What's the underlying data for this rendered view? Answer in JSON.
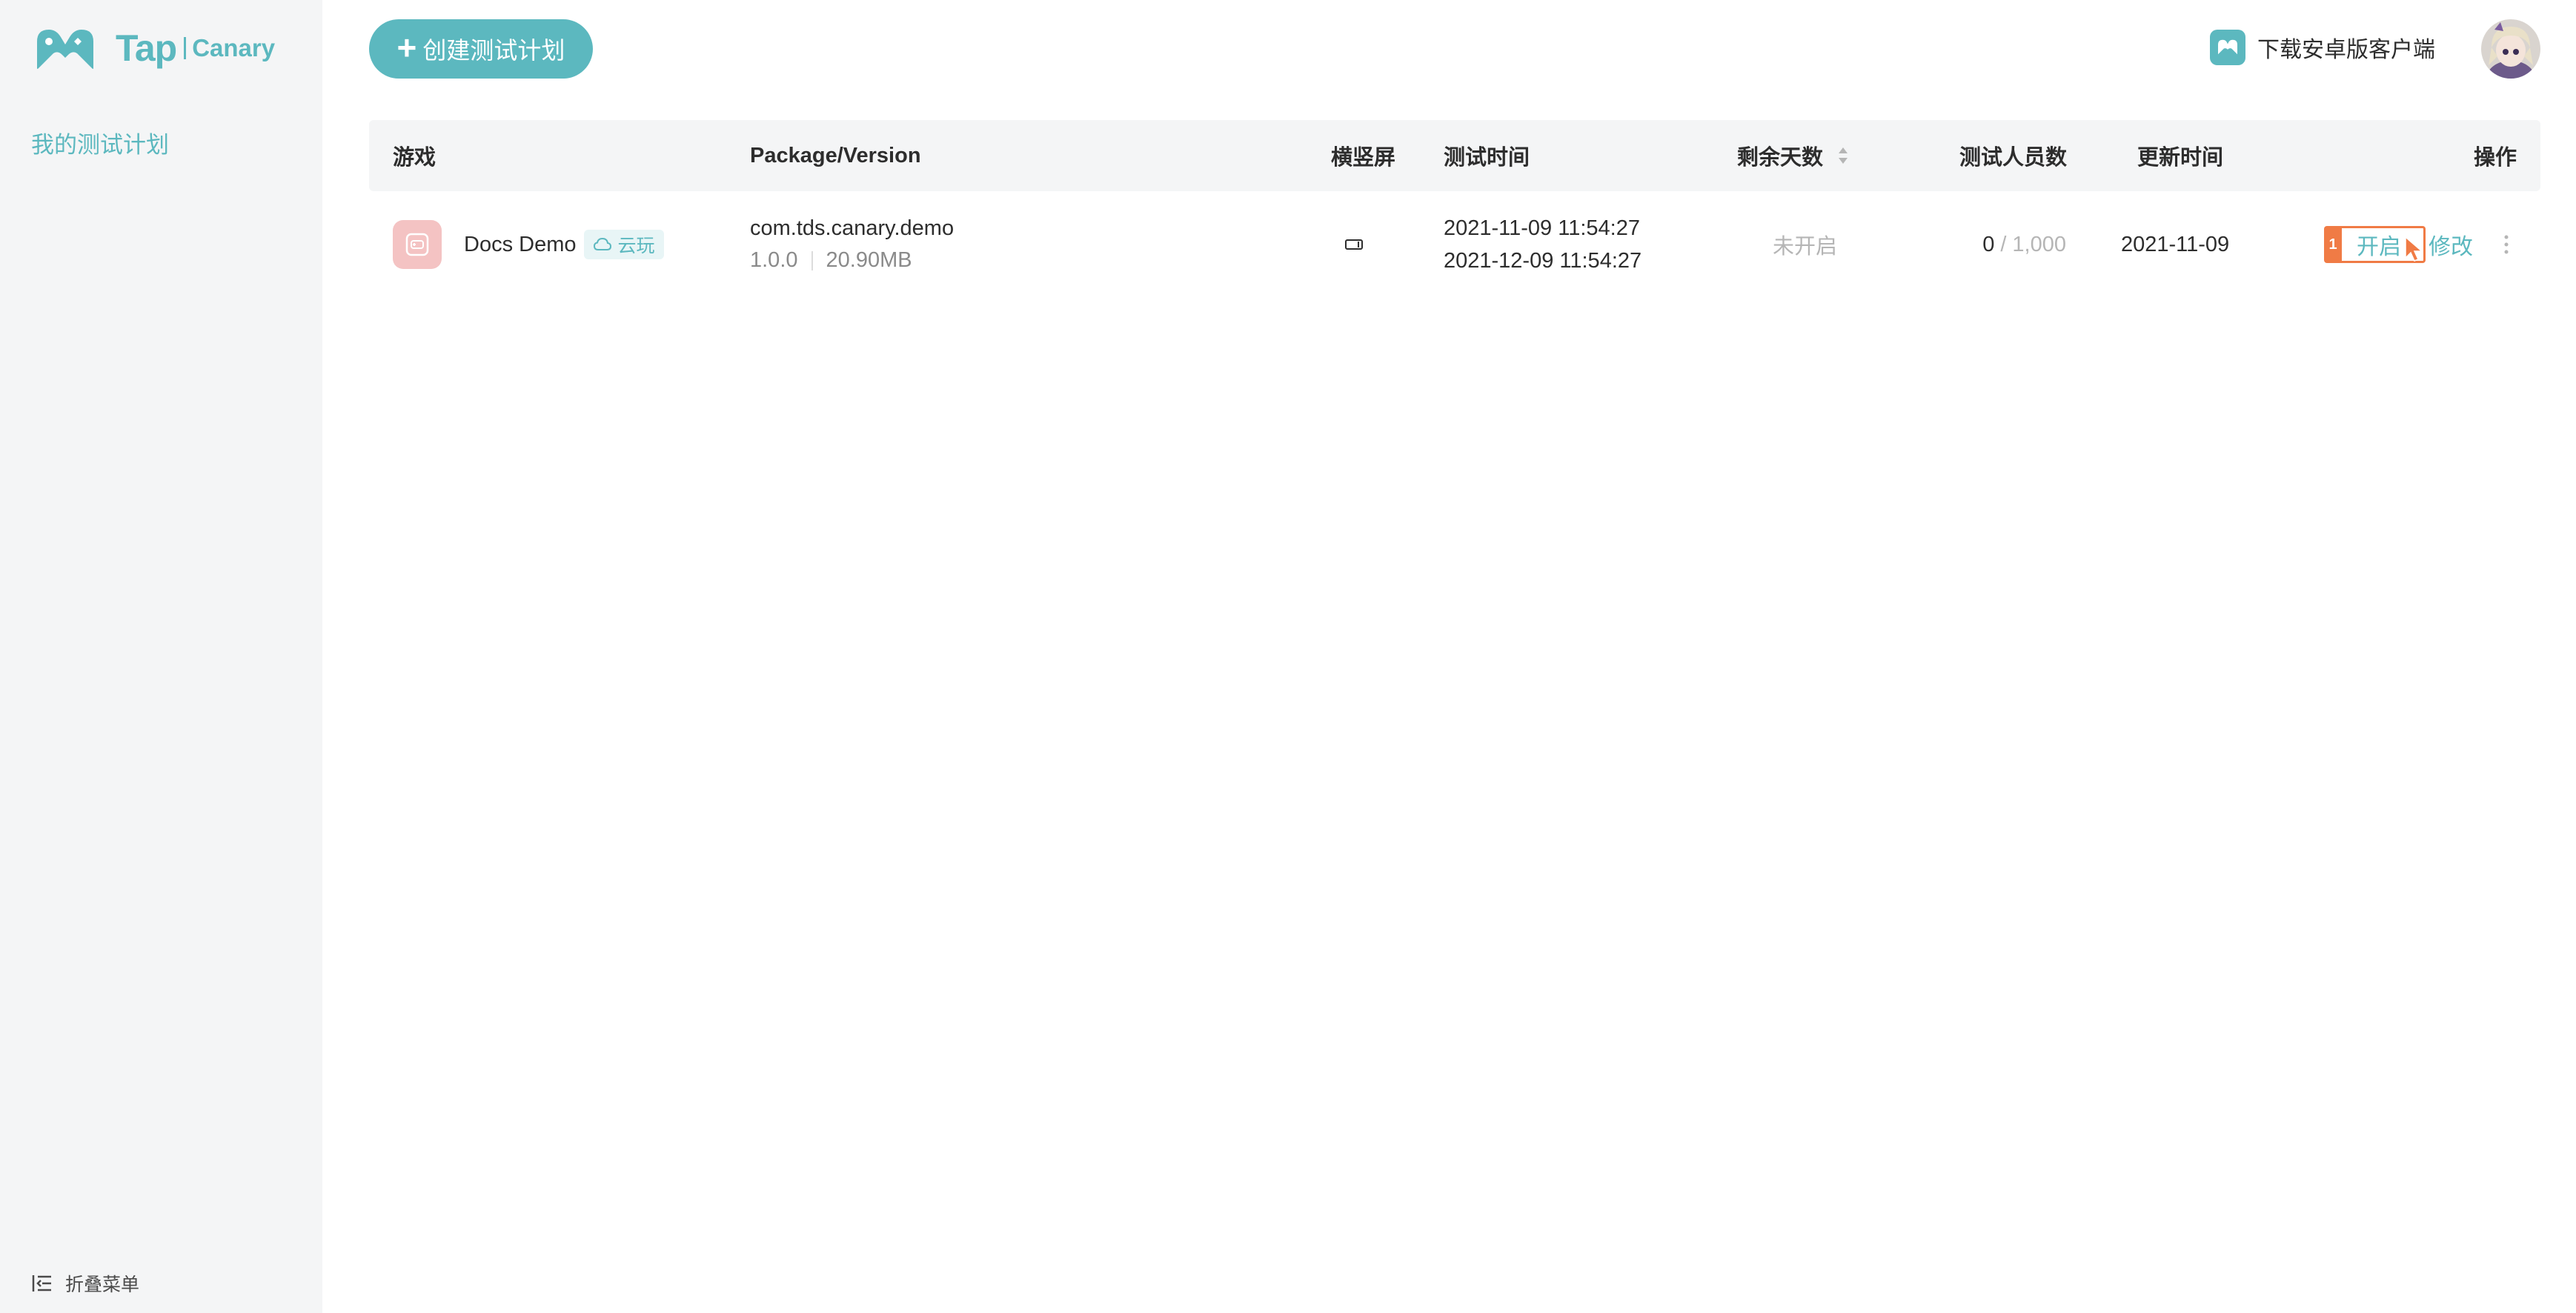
{
  "brand": {
    "name": "Tap",
    "product": "Canary",
    "color": "#5cb8bf"
  },
  "sidebar": {
    "nav_items": [
      {
        "label": "我的测试计划",
        "icon": "none"
      }
    ],
    "collapse_label": "折叠菜单",
    "collapse_icon": "collapse-menu-icon"
  },
  "header": {
    "create_button_label": "创建测试计划",
    "download_label": "下载安卓版客户端",
    "download_icon": "gamepad-icon",
    "avatar_icon": "user-avatar"
  },
  "table": {
    "columns": [
      {
        "key": "game",
        "label": "游戏"
      },
      {
        "key": "package",
        "label": "Package/Version"
      },
      {
        "key": "orientation",
        "label": "横竖屏"
      },
      {
        "key": "test_time",
        "label": "测试时间"
      },
      {
        "key": "remaining_days",
        "label": "剩余天数",
        "sortable": true
      },
      {
        "key": "testers",
        "label": "测试人员数"
      },
      {
        "key": "updated",
        "label": "更新时间"
      },
      {
        "key": "ops",
        "label": "操作"
      }
    ],
    "rows": [
      {
        "game_name": "Docs Demo",
        "badge": "云玩",
        "badge_icon": "cloud-icon",
        "package_name": "com.tds.canary.demo",
        "version": "1.0.0",
        "size": "20.90MB",
        "orientation_icon": "landscape-icon",
        "start_time": "2021-11-09 11:54:27",
        "end_time": "2021-12-09 11:54:27",
        "remaining_days": "未开启",
        "testers_count": "0",
        "testers_separator": "/",
        "testers_limit": "1,000",
        "updated": "2021-11-09",
        "ops": {
          "marker": "1",
          "open_label": "开启",
          "edit_label": "修改",
          "more_icon": "more-vertical-icon"
        }
      }
    ]
  }
}
